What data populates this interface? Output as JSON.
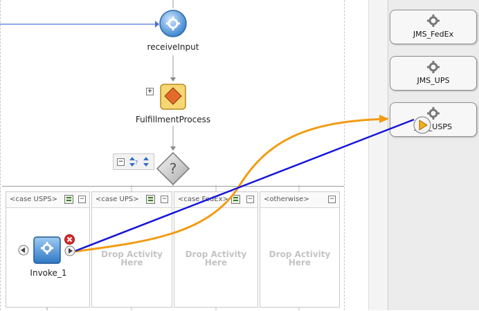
{
  "process": {
    "receive_label": "receiveInput",
    "fulfillment_label": "FulfillmentProcess",
    "switch_expand_symbol": "−",
    "scope_expand_symbol": "+"
  },
  "cases": [
    {
      "title": "<case USPS>",
      "collapse": "−",
      "drop": ""
    },
    {
      "title": "<case UPS>",
      "collapse": "−",
      "drop": "Drop Activity Here"
    },
    {
      "title": "<case FedEx>",
      "collapse": "−",
      "drop": "Drop Activity Here"
    },
    {
      "title": "<otherwise>",
      "collapse": "−",
      "drop": "Drop Activity Here"
    }
  ],
  "invoke": {
    "label": "Invoke_1"
  },
  "partner_links": [
    {
      "label": "JMS_FedEx"
    },
    {
      "label": "JMS_UPS"
    },
    {
      "label": "JMS_USPS"
    }
  ],
  "colors": {
    "activity_blue": "#5b9bd5",
    "scope_yellow": "#f7d774",
    "connector_blue": "#1515d8",
    "drag_orange": "#f29b12",
    "delete_red": "#d92b2b"
  },
  "icons": [
    "gear-icon",
    "diamond-icon",
    "question-icon",
    "left-arrow-icon",
    "right-arrow-icon",
    "close-icon",
    "condition-icon",
    "collapse-icon",
    "play-icon"
  ]
}
